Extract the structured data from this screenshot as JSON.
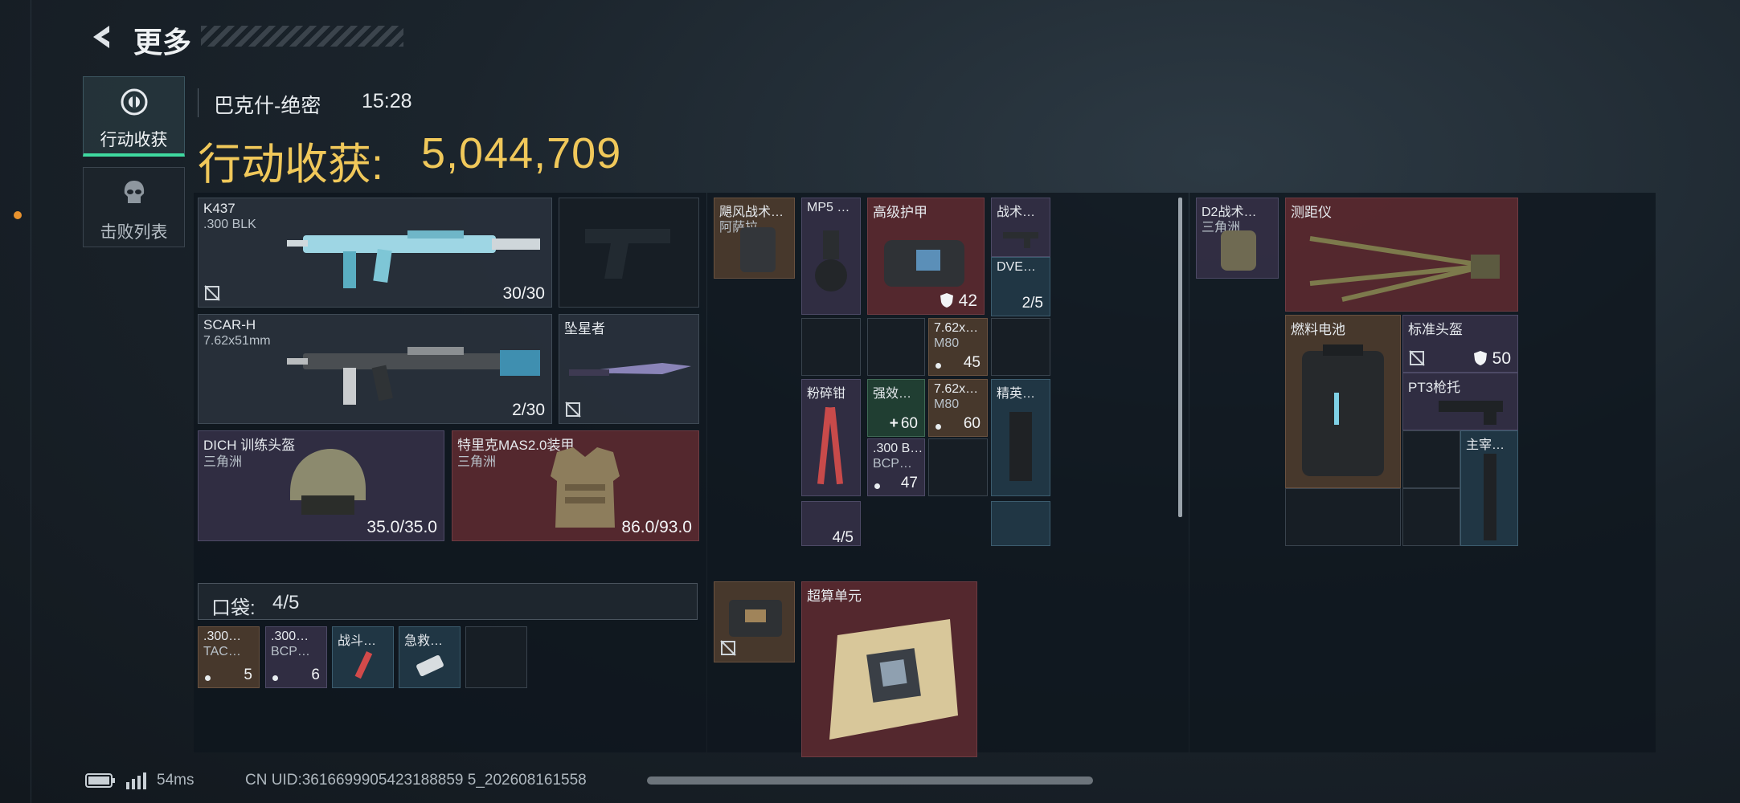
{
  "header": {
    "back_title": "更多"
  },
  "sidebar": {
    "tabs": [
      {
        "label": "行动收获"
      },
      {
        "label": "击败列表"
      }
    ]
  },
  "info": {
    "map": "巴克什-绝密",
    "time": "15:28",
    "harvest_label": "行动收获:",
    "harvest_value": "5,044,709"
  },
  "equipment": {
    "primary": {
      "name": "K437",
      "ammo": ".300 BLK",
      "count": "30/30"
    },
    "secondary": {
      "name": "SCAR-H",
      "ammo": "7.62x51mm",
      "count": "2/30"
    },
    "melee": {
      "name": "坠星者"
    },
    "helmet": {
      "name": "DICH 训练头盔",
      "brand": "三角洲",
      "durability": "35.0/35.0"
    },
    "armor": {
      "name": "特里克MAS2.0装甲",
      "brand": "三角洲",
      "durability": "86.0/93.0"
    }
  },
  "pockets": {
    "label": "口袋:",
    "value": "4/5",
    "items": [
      {
        "l1": ".300…",
        "l2": "TAC…",
        "count": "5"
      },
      {
        "l1": ".300…",
        "l2": "BCP…",
        "count": "6"
      },
      {
        "l1": "战斗…",
        "l2": "",
        "count": ""
      },
      {
        "l1": "急救…",
        "l2": "",
        "count": ""
      }
    ]
  },
  "chest_rig": {
    "name": "飓风战术…",
    "brand": "阿萨拉"
  },
  "backpack_items": [
    {
      "label": "MP5 …"
    },
    {
      "label": "高级护甲",
      "count": "42"
    },
    {
      "label": "战术…"
    },
    {
      "label": "DVE…",
      "count": "2/5"
    },
    {
      "label": "7.62x…",
      "sub": "M80",
      "count": "45"
    },
    {
      "label": "粉碎钳"
    },
    {
      "label": "强效…",
      "count": "60"
    },
    {
      "label": "7.62x…",
      "sub": "M80",
      "count": "60"
    },
    {
      "label": "精英…"
    },
    {
      "label": ".300 B…",
      "sub": "BCP…",
      "count": "47"
    },
    {
      "label": "",
      "count": "4/5"
    }
  ],
  "safe_box": {
    "item": "超算单元"
  },
  "backpack_right": {
    "name": "D2战术…",
    "brand": "三角洲"
  },
  "right_items": [
    {
      "label": "测距仪"
    },
    {
      "label": "燃料电池"
    },
    {
      "label": "标准头盔",
      "count": "50"
    },
    {
      "label": "PT3枪托"
    },
    {
      "label": "主宰…"
    }
  ],
  "status": {
    "ping": "54ms",
    "uid": "CN UID:3616699905423188859 5_202608161558"
  },
  "colors": {
    "gold": "#f0c85a",
    "accent_green": "#3fd9a0",
    "red_slot": "#5c2a30"
  }
}
